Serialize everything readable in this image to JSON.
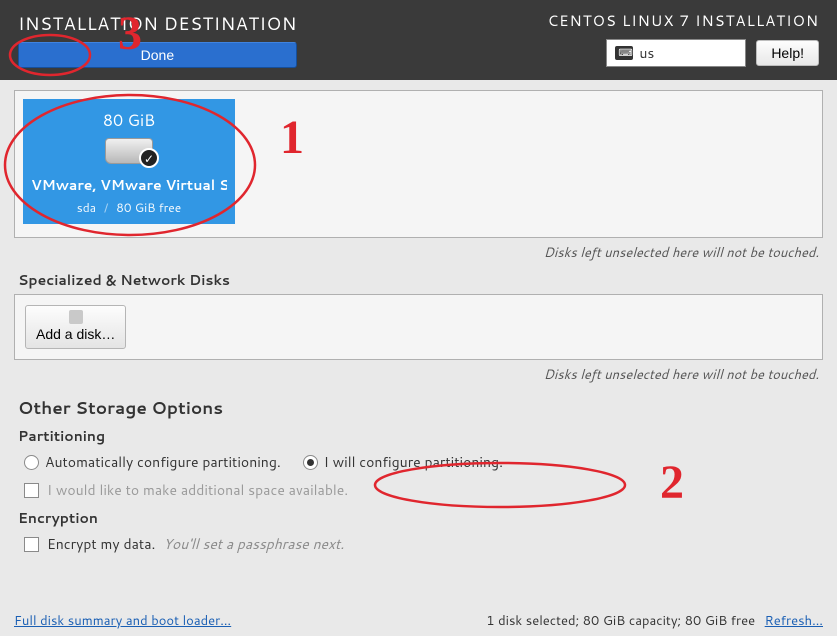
{
  "header": {
    "title": "INSTALLATION DESTINATION",
    "done_label": "Done",
    "app_title": "CENTOS LINUX 7 INSTALLATION",
    "kb_layout": "us",
    "help_label": "Help!"
  },
  "disks": {
    "hint": "Disks left unselected here will not be touched.",
    "items": [
      {
        "size": "80 GiB",
        "name": "VMware, VMware Virtual S",
        "dev": "sda",
        "free": "80 GiB free",
        "selected": true
      }
    ]
  },
  "network_disks": {
    "label": "Specialized & Network Disks",
    "add_label": "Add a disk…",
    "hint": "Disks left unselected here will not be touched."
  },
  "storage_options": {
    "heading": "Other Storage Options",
    "partitioning_label": "Partitioning",
    "auto_label": "Automatically configure partitioning.",
    "manual_label": "I will configure partitioning.",
    "selected": "manual",
    "extra_space_label": "I would like to make additional space available.",
    "extra_space_enabled": false,
    "encryption_label": "Encryption",
    "encrypt_label": "Encrypt my data.",
    "encrypt_hint": "You'll set a passphrase next.",
    "encrypt_checked": false
  },
  "footer": {
    "summary_link": "Full disk summary and boot loader…",
    "status": "1 disk selected; 80 GiB capacity; 80 GiB free",
    "refresh_link": "Refresh…"
  },
  "annotations": {
    "n1": "1",
    "n2": "2",
    "n3": "3"
  }
}
